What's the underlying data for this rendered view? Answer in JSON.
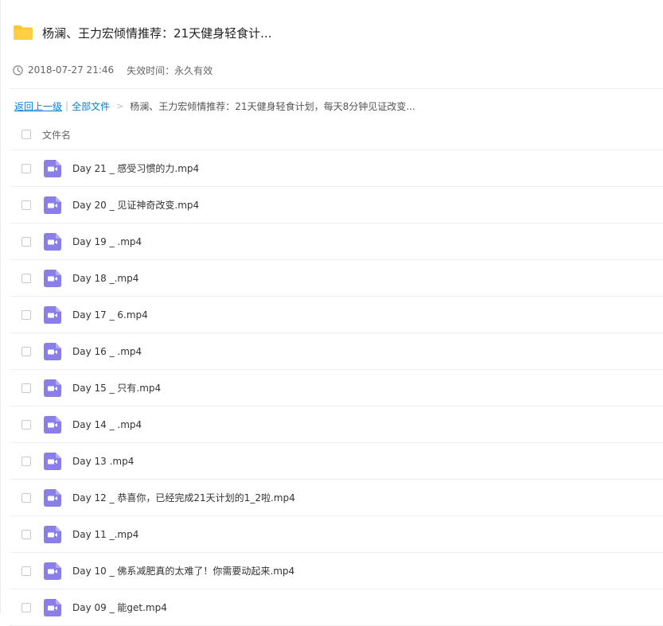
{
  "header": {
    "title": "杨澜、王力宏倾情推荐：21天健身轻食计..."
  },
  "meta": {
    "date": "2018-07-27 21:46",
    "expiry": "失效时间：永久有效"
  },
  "breadcrumb": {
    "back": "返回上一级",
    "separator": "|",
    "all_files": "全部文件",
    "arrow": ">",
    "current": "杨澜、王力宏倾情推荐：21天健身轻食计划，每天8分钟见证改变..."
  },
  "list": {
    "column_name": "文件名",
    "files": [
      "Day 21 _ 感受习惯的力.mp4",
      "Day 20 _ 见证神奇改变.mp4",
      "Day 19 _ .mp4",
      "Day 18 _.mp4",
      "Day 17 _ 6.mp4",
      "Day 16 _ .mp4",
      "Day 15 _ 只有.mp4",
      "Day 14 _ .mp4",
      "Day 13 .mp4",
      "Day 12 _ 恭喜你，已经完成21天计划的1_2啦.mp4",
      "Day 11 _.mp4",
      "Day 10 _ 佛系减肥真的太难了！你需要动起来.mp4",
      "Day 09 _ 能get.mp4"
    ]
  },
  "colors": {
    "folder": "#FFC72B",
    "video": "#8A7FE8",
    "link": "#0B7FD6"
  },
  "icons": {
    "folder": "folder-icon",
    "clock": "clock-icon",
    "video": "video-file-icon"
  }
}
